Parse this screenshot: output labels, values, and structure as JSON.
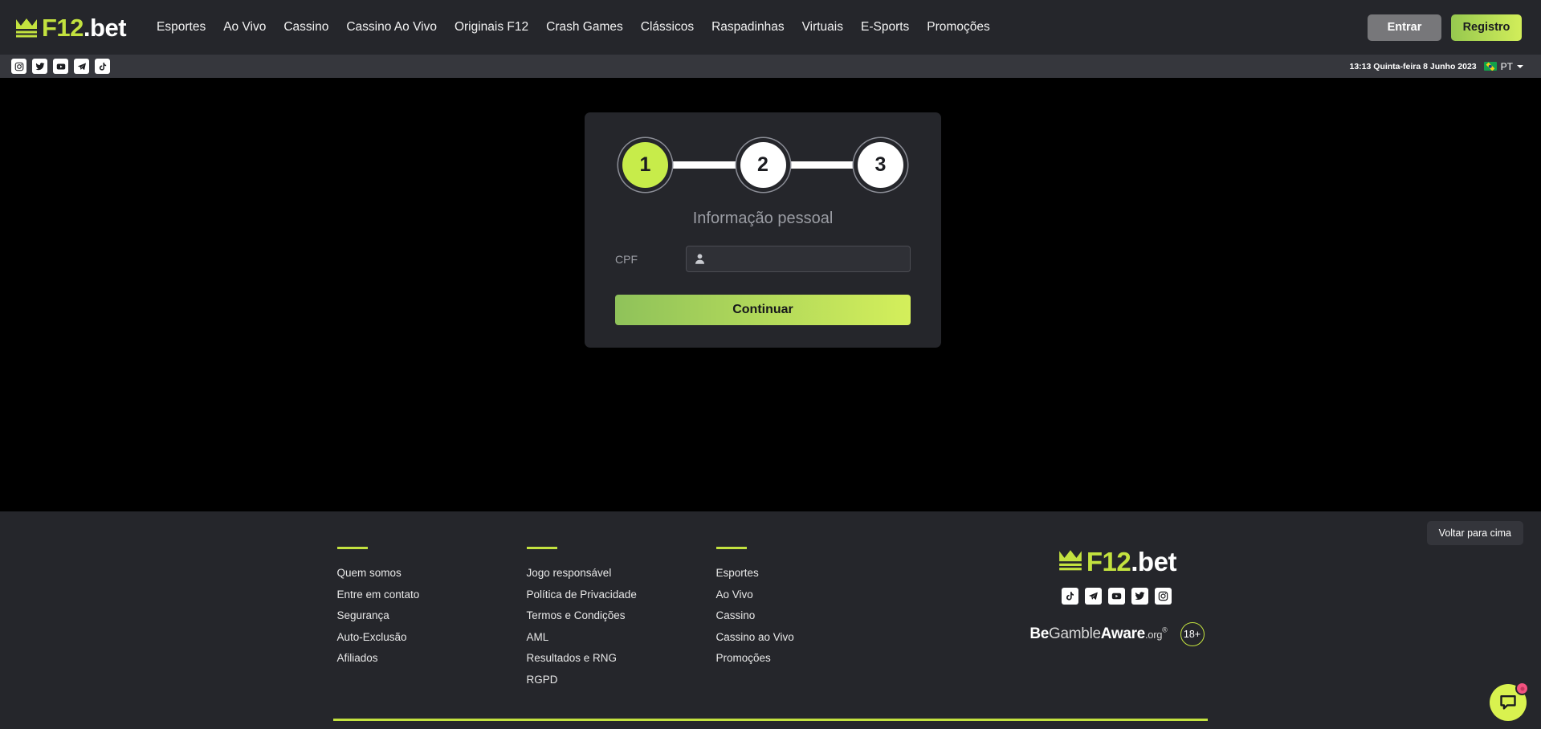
{
  "brand": {
    "name_green": "F12",
    "name_white": ".bet",
    "accent": "#c3e23f",
    "crown_icon": "crown-icon"
  },
  "header": {
    "nav": [
      {
        "label": "Esportes"
      },
      {
        "label": "Ao Vivo"
      },
      {
        "label": "Cassino"
      },
      {
        "label": "Cassino Ao Vivo"
      },
      {
        "label": "Originais F12"
      },
      {
        "label": "Crash Games"
      },
      {
        "label": "Clássicos"
      },
      {
        "label": "Raspadinhas"
      },
      {
        "label": "Virtuais"
      },
      {
        "label": "E-Sports"
      },
      {
        "label": "Promoções"
      }
    ],
    "login_label": "Entrar",
    "register_label": "Registro"
  },
  "subheader": {
    "socials": [
      {
        "name": "instagram-icon"
      },
      {
        "name": "twitter-icon"
      },
      {
        "name": "youtube-icon"
      },
      {
        "name": "telegram-icon"
      },
      {
        "name": "tiktok-icon"
      }
    ],
    "datetime": "13:13 Quinta-feira 8 Junho 2023",
    "language_code": "PT",
    "flag": "brazil-flag-icon"
  },
  "registration": {
    "steps": [
      {
        "number": "1",
        "active": true
      },
      {
        "number": "2",
        "active": false
      },
      {
        "number": "3",
        "active": false
      }
    ],
    "title": "Informação pessoal",
    "cpf_label": "CPF",
    "cpf_value": "",
    "cpf_placeholder": "",
    "cpf_icon": "user-icon",
    "continue_label": "Continuar"
  },
  "footer": {
    "columns": [
      {
        "links": [
          {
            "label": "Quem somos"
          },
          {
            "label": "Entre em contato"
          },
          {
            "label": "Segurança"
          },
          {
            "label": "Auto-Exclusão"
          },
          {
            "label": "Afiliados"
          }
        ]
      },
      {
        "links": [
          {
            "label": "Jogo responsável"
          },
          {
            "label": "Política de Privacidade"
          },
          {
            "label": "Termos e Condições"
          },
          {
            "label": "AML"
          },
          {
            "label": "Resultados e RNG"
          },
          {
            "label": "RGPD"
          }
        ]
      },
      {
        "links": [
          {
            "label": "Esportes"
          },
          {
            "label": "Ao Vivo"
          },
          {
            "label": "Cassino"
          },
          {
            "label": "Cassino ao Vivo"
          },
          {
            "label": "Promoções"
          }
        ]
      }
    ],
    "socials": [
      {
        "name": "tiktok-icon"
      },
      {
        "name": "telegram-icon"
      },
      {
        "name": "youtube-icon"
      },
      {
        "name": "twitter-icon"
      },
      {
        "name": "instagram-icon"
      }
    ],
    "gamble_aware": {
      "be": "Be",
      "gamble": "Gamble",
      "aware": "Aware",
      "org": ".org",
      "registered": "®"
    },
    "age_badge": "18+",
    "back_to_top": "Voltar para cima"
  },
  "chat": {
    "name": "chat-bubble-icon",
    "has_notification": true
  }
}
